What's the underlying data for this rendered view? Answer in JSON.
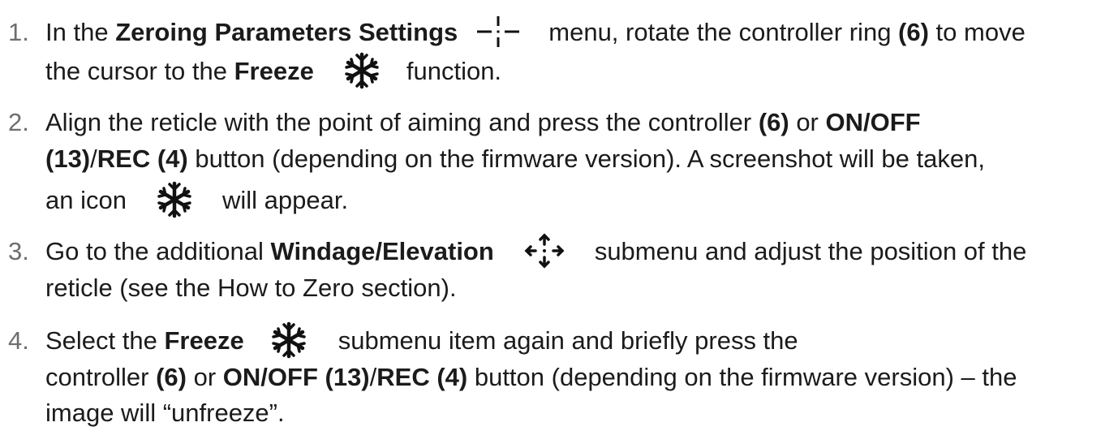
{
  "steps": [
    {
      "number": "1.",
      "line1": {
        "t1": "In the ",
        "b1": "Zeroing Parameters Settings",
        "t2": "menu, rotate the controller ring ",
        "b2": "(6)",
        "t3": " to move"
      },
      "line2": {
        "t1": "the cursor to the ",
        "b1": "Freeze",
        "t2": "function."
      },
      "icons": [
        "crosshair-icon",
        "snowflake-icon"
      ]
    },
    {
      "number": "2.",
      "line1": {
        "t1": "Align the reticle with the point of aiming and press the controller ",
        "b1": "(6)",
        "t2": " or ",
        "b2": "ON/OFF"
      },
      "line2": {
        "b1": "(13)",
        "t1": "/",
        "b2": "REC (4)",
        "t2": " button (depending on the firmware version). A screenshot will be taken,"
      },
      "line3": {
        "t1": "an icon",
        "t2": "will appear."
      },
      "icons": [
        "snowflake-icon"
      ]
    },
    {
      "number": "3.",
      "line1": {
        "t1": "Go to the additional ",
        "b1": "Windage/Elevation",
        "t2": "submenu and adjust the position of the"
      },
      "line2": {
        "t1": "reticle (see the ",
        "t2": "How to Zero",
        "t3": " section)."
      },
      "icons": [
        "four-arrows-icon"
      ]
    },
    {
      "number": "4.",
      "line1": {
        "t1": "Select the ",
        "b1": "Freeze",
        "t2": "submenu item again and briefly press the"
      },
      "line2": {
        "t1": "controller ",
        "b1": "(6)",
        "t2": " or ",
        "b2": "ON/OFF (13)",
        "t3": "/",
        "b3": "REC (4)",
        "t4": " button (depending on the firmware version) – the"
      },
      "line3": {
        "t1": "image will “unfreeze”."
      },
      "icons": [
        "snowflake-icon"
      ]
    }
  ]
}
